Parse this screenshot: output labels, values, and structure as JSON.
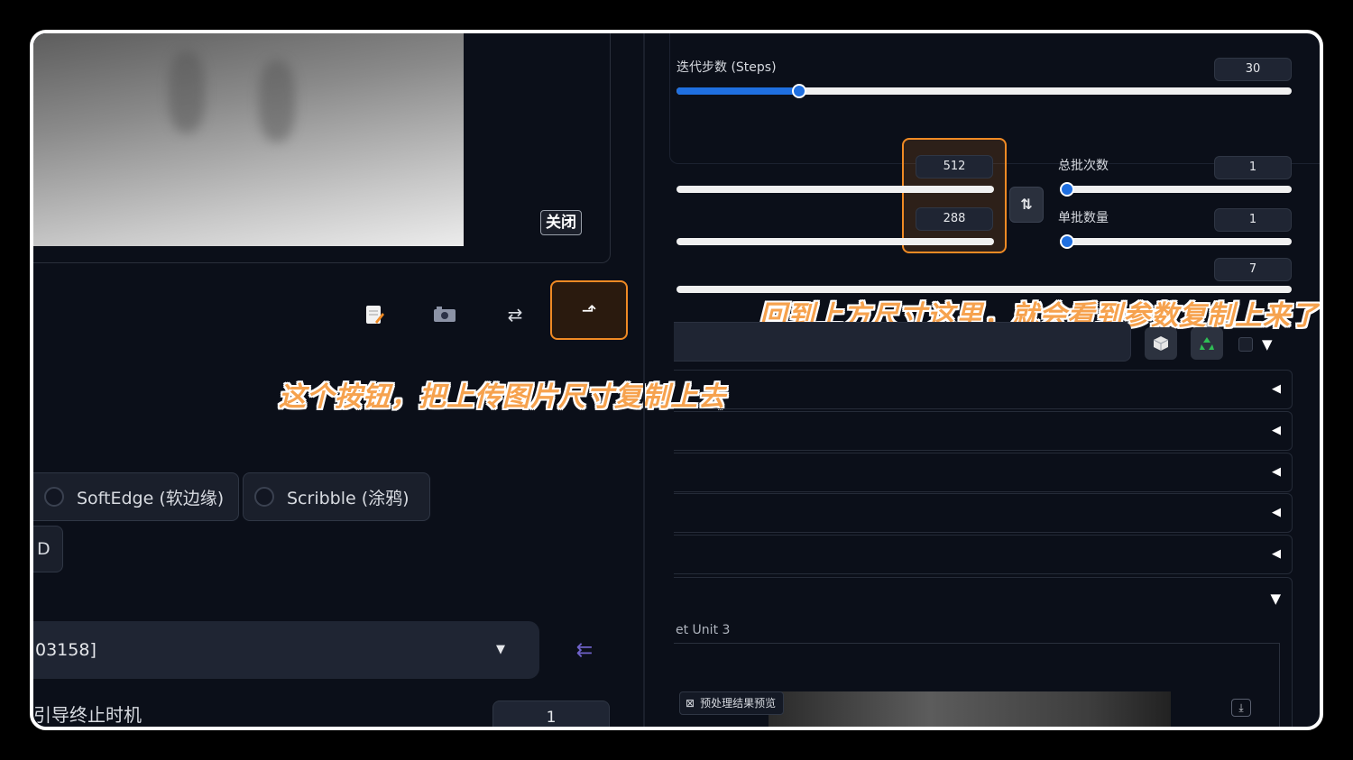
{
  "left": {
    "close_label": "关闭",
    "tools": {
      "edit_icon": "edit-icon",
      "camera_icon": "camera-icon",
      "swap_icon": "⇄",
      "copy_size_icon": "⬏"
    },
    "annotation": "这个按钮，把上传图片尺寸复制上去",
    "control_types": [
      "SoftEdge (软边缘)",
      "Scribble (涂鸦)"
    ],
    "partial_pill": "D",
    "model_value": "03158]",
    "guidance_end_label": "引导终止时机",
    "guidance_end_value": "1"
  },
  "right": {
    "steps": {
      "label": "迭代步数 (Steps)",
      "value": "30",
      "fraction": 0.2
    },
    "width": {
      "value": "512",
      "fraction": 1.0
    },
    "height": {
      "value": "288",
      "fraction": 1.0
    },
    "batch_count": {
      "label": "总批次数",
      "value": "1",
      "fraction": 0.0
    },
    "batch_size": {
      "label": "单批数量",
      "value": "1",
      "fraction": 0.0
    },
    "cfg": {
      "value": "7"
    },
    "annotation": "回到上方尺寸这里，就会看到参数复制上来了",
    "swap_dims_icon": "⇅",
    "unit_label": "et Unit 3",
    "preproc_label": "预处理结果预览"
  }
}
